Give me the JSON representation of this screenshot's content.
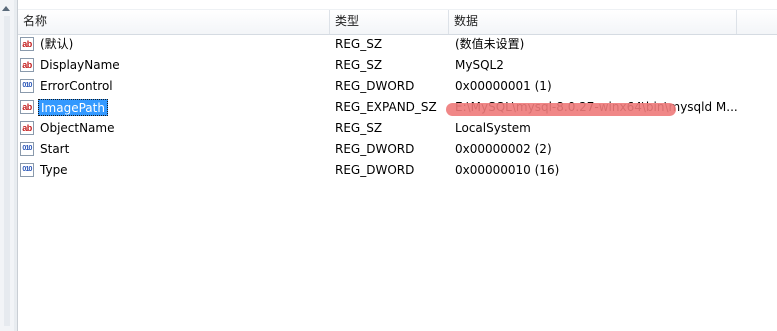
{
  "columns": {
    "name": "名称",
    "type": "类型",
    "data": "数据"
  },
  "rows": [
    {
      "name": "(默认)",
      "type": "REG_SZ",
      "data": "(数值未设置)",
      "icon": "ab"
    },
    {
      "name": "DisplayName",
      "type": "REG_SZ",
      "data": "MySQL2",
      "icon": "ab"
    },
    {
      "name": "ErrorControl",
      "type": "REG_DWORD",
      "data": "0x00000001 (1)",
      "icon": "bin"
    },
    {
      "name": "ImagePath",
      "type": "REG_EXPAND_SZ",
      "data": "E:\\MySQL\\mysql-8.0.27-winx64\\bin\\mysqld M...",
      "icon": "ab"
    },
    {
      "name": "ObjectName",
      "type": "REG_SZ",
      "data": "LocalSystem",
      "icon": "ab"
    },
    {
      "name": "Start",
      "type": "REG_DWORD",
      "data": "0x00000002 (2)",
      "icon": "bin"
    },
    {
      "name": "Type",
      "type": "REG_DWORD",
      "data": "0x00000010 (16)",
      "icon": "bin"
    }
  ],
  "icons": {
    "ab": "ab",
    "bin": "010"
  },
  "selected_row": "ImagePath",
  "colors": {
    "selection": "#3399ff",
    "string_icon": "#c41e1e",
    "binary_icon": "#2b57b8",
    "highlight_mark": "#ee7a7a"
  }
}
